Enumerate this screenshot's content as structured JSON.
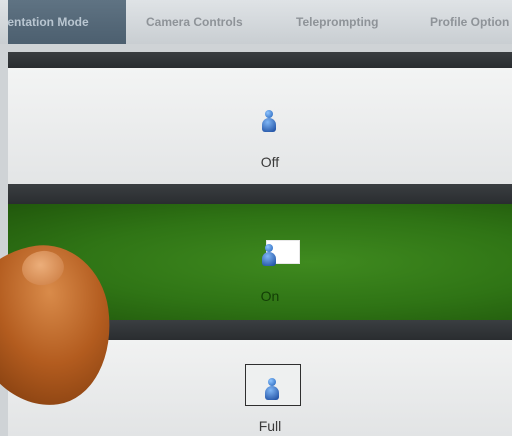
{
  "tabs": [
    {
      "label": "esentation Mode",
      "active": true
    },
    {
      "label": "Camera Controls",
      "active": false
    },
    {
      "label": "Teleprompting",
      "active": false
    },
    {
      "label": "Profile Option",
      "active": false
    }
  ],
  "options": {
    "off": {
      "label": "Off",
      "icon": "person-icon"
    },
    "on": {
      "label": "On",
      "icon": "person-with-inset-icon",
      "selected": true
    },
    "full": {
      "label": "Full",
      "icon": "person-in-frame-icon"
    }
  },
  "colors": {
    "selected_green": "#2f7415",
    "active_tab": "#5f7383",
    "separator": "#2e3134",
    "icon_blue": "#1e5fb8"
  }
}
